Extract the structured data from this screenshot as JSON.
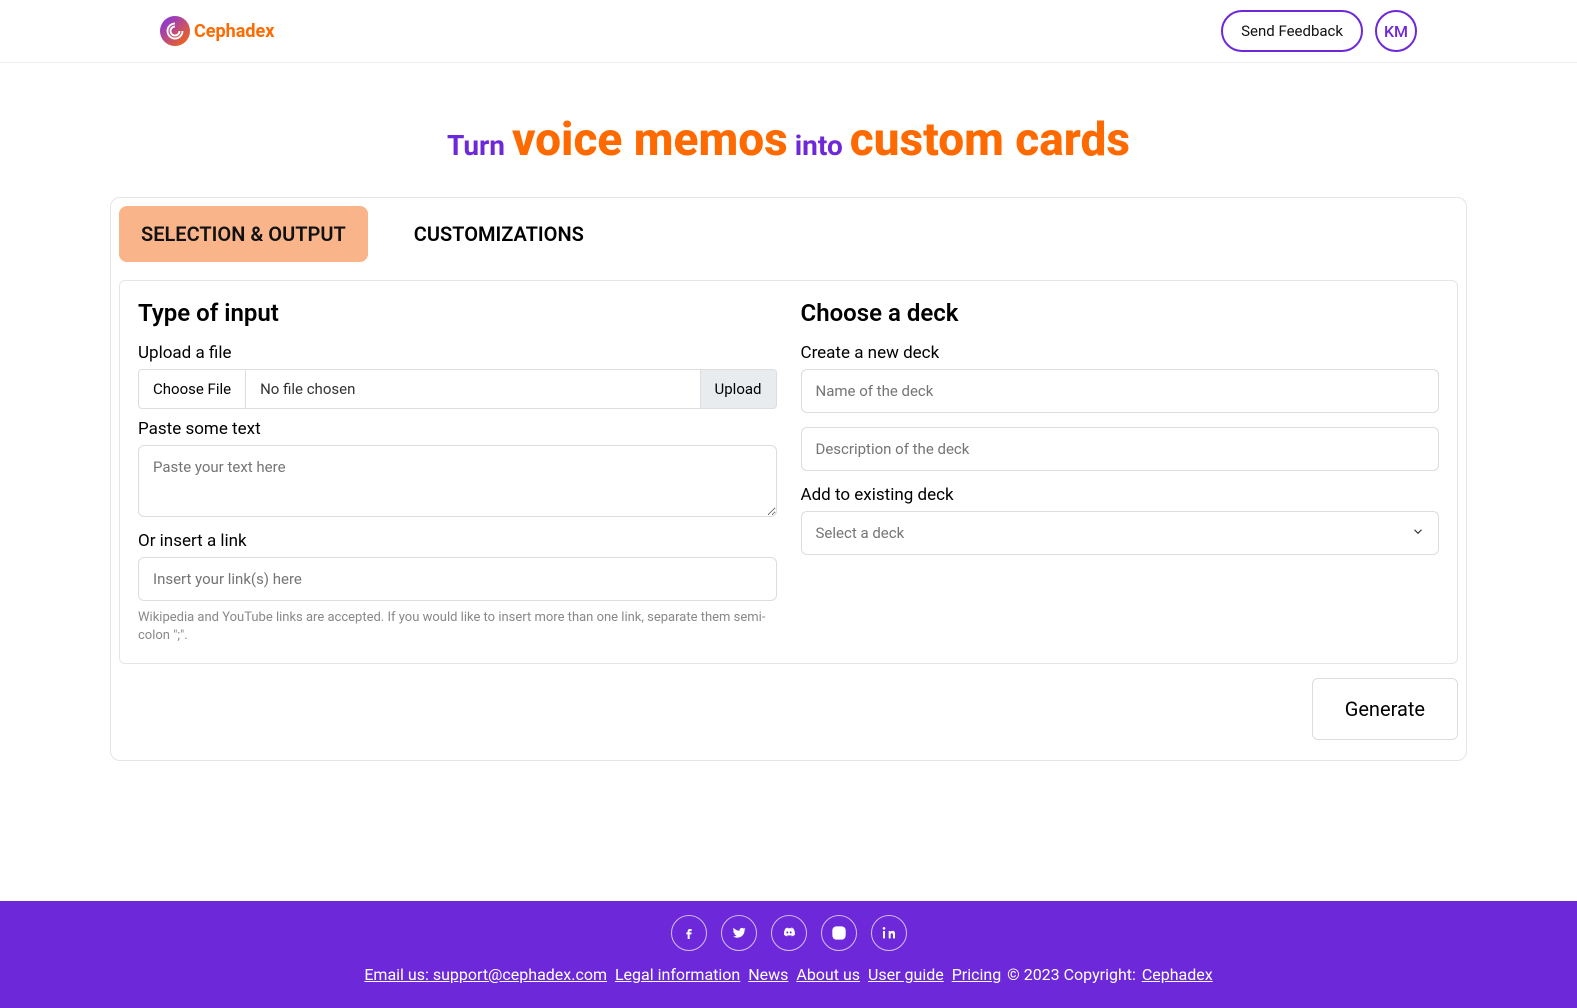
{
  "header": {
    "brand": "Cephadex",
    "feedback_label": "Send Feedback",
    "avatar_initials": "KM"
  },
  "hero": {
    "turn": "Turn ",
    "big1": "voice memos",
    "into": " into ",
    "big2": "custom cards"
  },
  "tabs": {
    "selection": "SELECTION & OUTPUT",
    "custom": "CUSTOMIZATIONS"
  },
  "left": {
    "title": "Type of input",
    "upload_label": "Upload a file",
    "choose_file": "Choose File",
    "no_file": "No file chosen",
    "upload_btn": "Upload",
    "paste_label": "Paste some text",
    "paste_placeholder": "Paste your text here",
    "link_label": "Or insert a link",
    "link_placeholder": "Insert your link(s) here",
    "hint": "Wikipedia and YouTube links are accepted. If you would like to insert more than one link, separate them semi-colon \";\"."
  },
  "right": {
    "title": "Choose a deck",
    "create_label": "Create a new deck",
    "name_placeholder": "Name of the deck",
    "desc_placeholder": "Description of the deck",
    "existing_label": "Add to existing deck",
    "select_placeholder": "Select a deck"
  },
  "generate_label": "Generate",
  "footer": {
    "email": "Email us: support@cephadex.com",
    "legal": "Legal information",
    "news": "News",
    "about": "About us",
    "guide": "User guide",
    "pricing": "Pricing",
    "copyright": " © 2023 Copyright: ",
    "brand": "Cephadex"
  }
}
